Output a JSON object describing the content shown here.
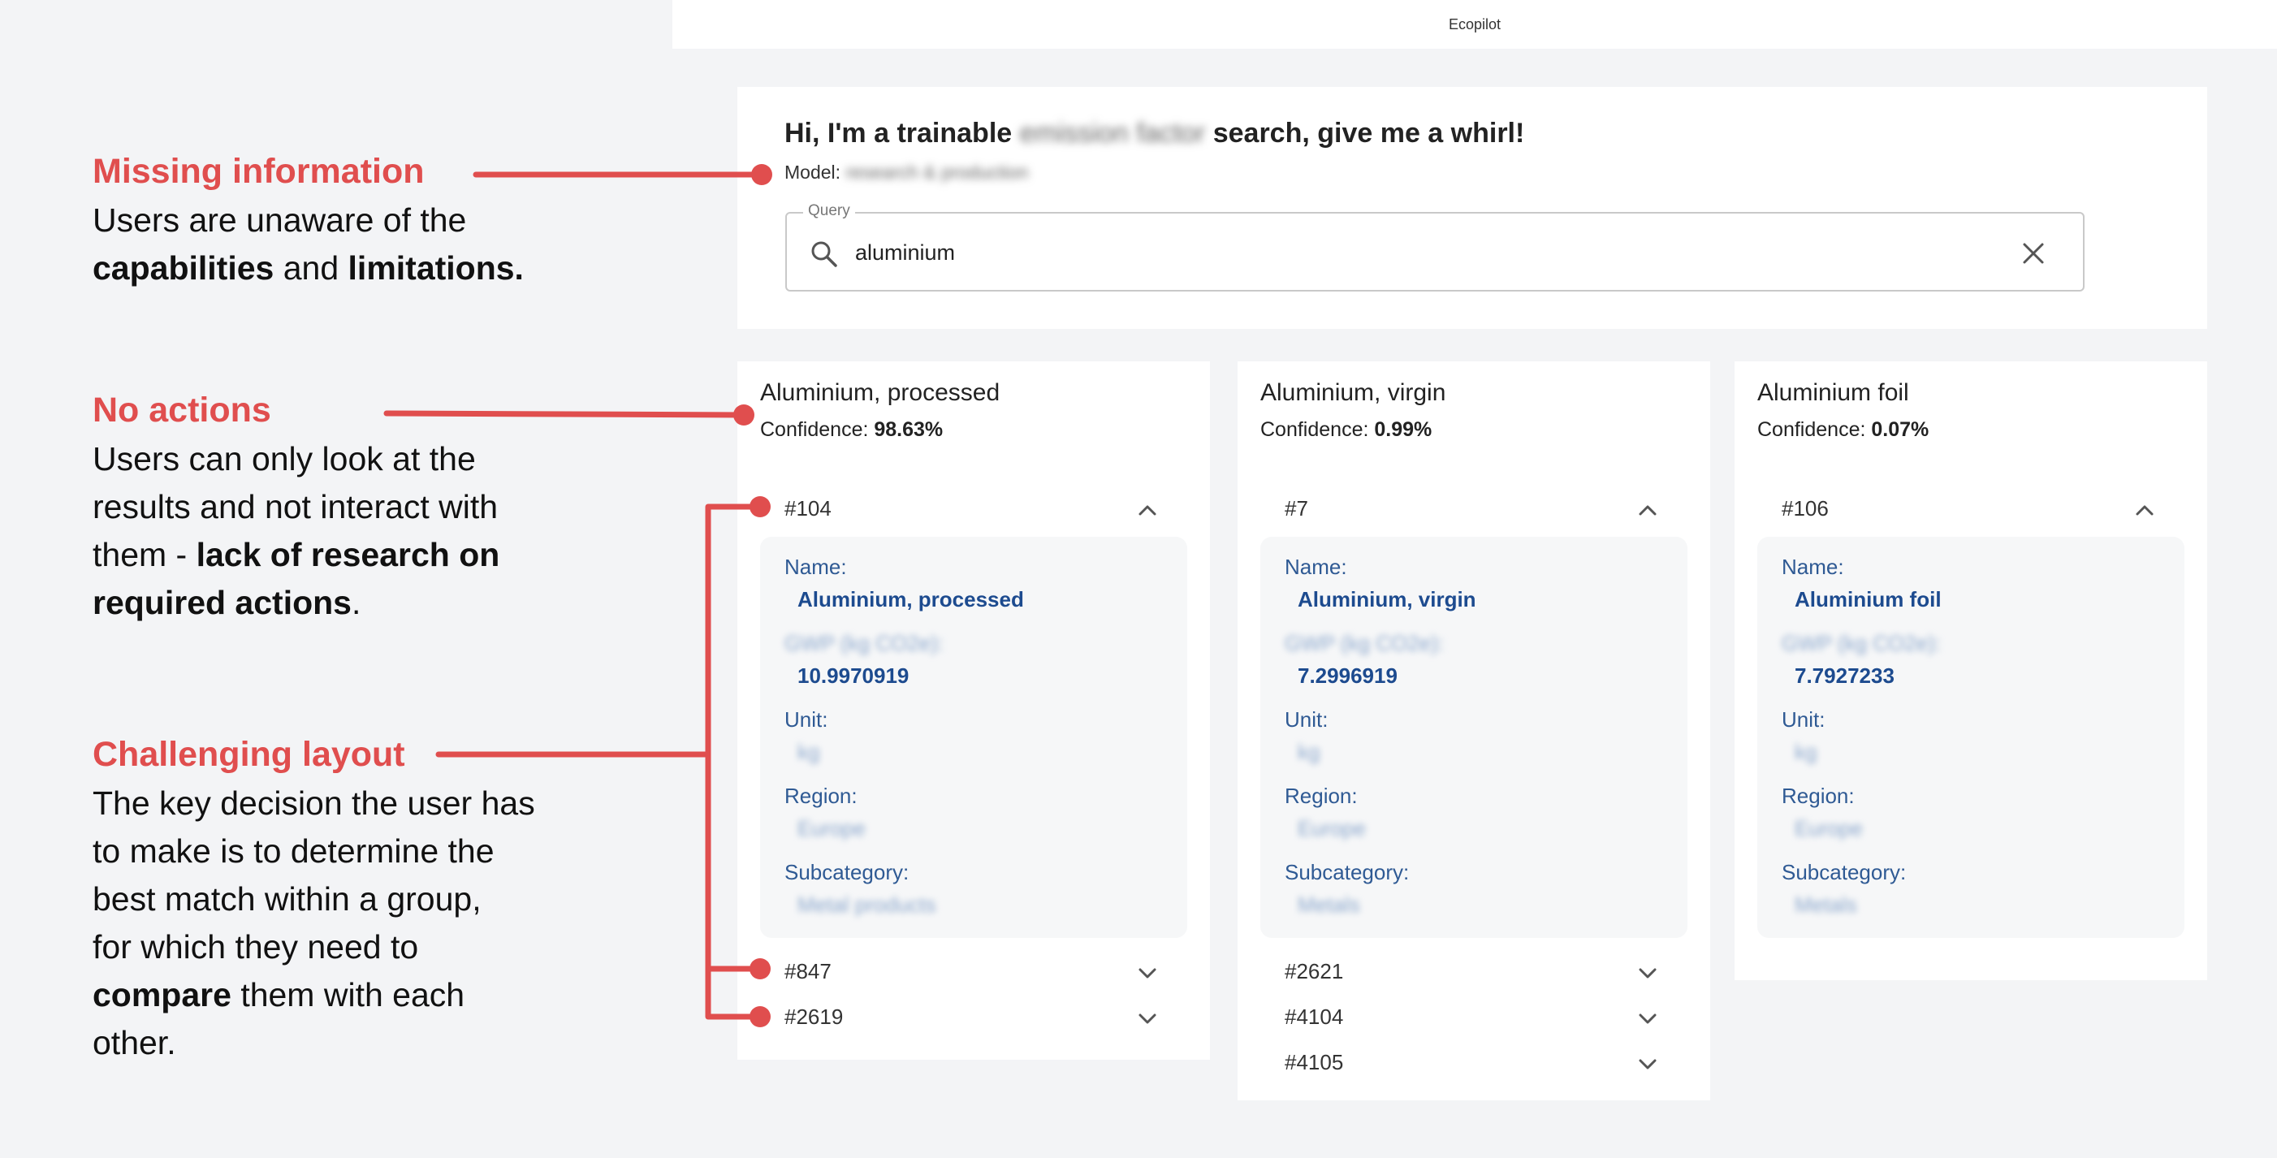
{
  "annotations": {
    "missing": {
      "title": "Missing information",
      "line1": "Users are unaware of the",
      "bold_a": "capabilities",
      "and": " and ",
      "bold_b": "limitations."
    },
    "no_actions": {
      "title": "No actions",
      "line1": "Users can only look at the",
      "line2": "results and not interact with",
      "line3_pre": "them - ",
      "line3_bold": "lack of research on",
      "line4_bold": "required actions",
      "line4_post": "."
    },
    "layout": {
      "title": "Challenging layout",
      "line1": "The key decision the user has",
      "line2": "to make is to determine the",
      "line3": "best match within a group,",
      "line4": "for which they need to",
      "line5_bold": "compare",
      "line5_post": " them with each",
      "line6": "other."
    }
  },
  "app": {
    "title": "Ecopilot",
    "greeting_pre": "Hi, I'm a trainable ",
    "greeting_blurred": "emission factor",
    "greeting_post": " search, give me a whirl!",
    "model_label": "Model:",
    "model_value": "research & production",
    "query_label": "Query",
    "query_value": "aluminium"
  },
  "results": [
    {
      "title": "Aluminium, processed",
      "confidence_label": "Confidence: ",
      "confidence": "98.63%",
      "expanded_id": "#104",
      "name_label": "Name:",
      "name": "Aluminium, processed",
      "factor_label": "GWP (kg CO2e):",
      "factor": "10.9970919",
      "unit_label": "Unit:",
      "unit": "kg",
      "region_label": "Region:",
      "region": "Europe",
      "subcategory_label": "Subcategory:",
      "subcategory": "Metal products",
      "collapsed": [
        "#847",
        "#2619"
      ]
    },
    {
      "title": "Aluminium, virgin",
      "confidence_label": "Confidence: ",
      "confidence": "0.99%",
      "expanded_id": "#7",
      "name_label": "Name:",
      "name": "Aluminium, virgin",
      "factor_label": "GWP (kg CO2e):",
      "factor": "7.2996919",
      "unit_label": "Unit:",
      "unit": "kg",
      "region_label": "Region:",
      "region": "Europe",
      "subcategory_label": "Subcategory:",
      "subcategory": "Metals",
      "collapsed": [
        "#2621",
        "#4104",
        "#4105"
      ]
    },
    {
      "title": "Aluminium foil",
      "confidence_label": "Confidence: ",
      "confidence": "0.07%",
      "expanded_id": "#106",
      "name_label": "Name:",
      "name": "Aluminium foil",
      "factor_label": "GWP (kg CO2e):",
      "factor": "7.7927233",
      "unit_label": "Unit:",
      "unit": "kg",
      "region_label": "Region:",
      "region": "Europe",
      "subcategory_label": "Subcategory:",
      "subcategory": "Metals",
      "collapsed": []
    }
  ],
  "colors": {
    "annotation_red": "#e04e4e",
    "value_blue": "#1d4b8f",
    "label_blue": "#2f5a94"
  }
}
